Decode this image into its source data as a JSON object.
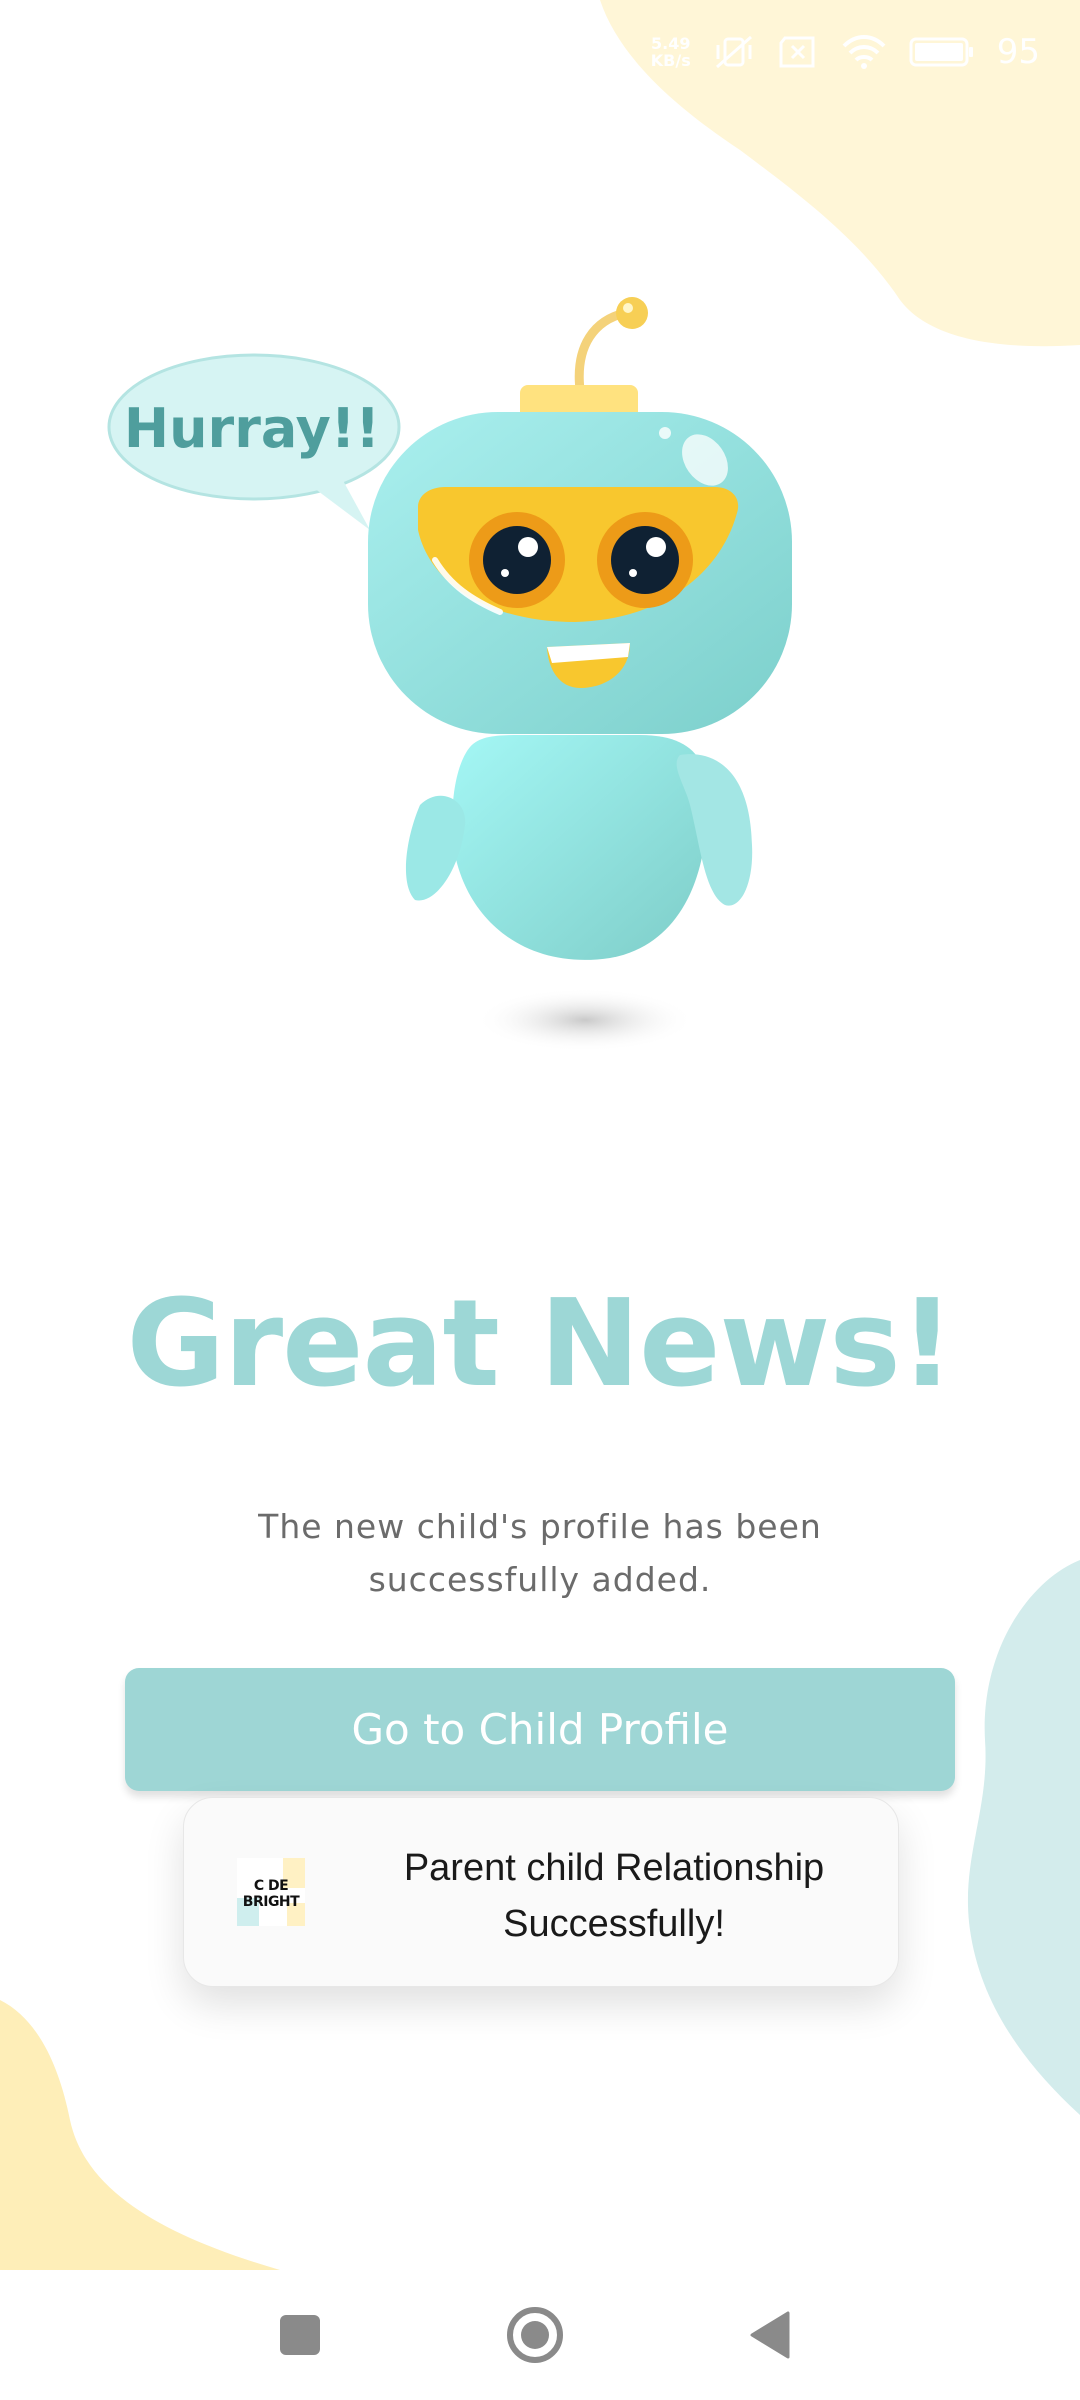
{
  "status_bar": {
    "net_speed_value": "5.49",
    "net_speed_unit": "KB/s",
    "battery_percent": "95"
  },
  "mascot": {
    "speech_bubble": "Hurray!!"
  },
  "main": {
    "title": "Great News!",
    "message": "The new child's profile has been successfully added.",
    "cta_label": "Go to Child Profile"
  },
  "toast": {
    "logo_line1": "C DE",
    "logo_line2": "BRIGHT",
    "message": "Parent child Relationship Successfully!"
  },
  "colors": {
    "teal": "#9ed6d5",
    "yellow_blob": "#fff6d6",
    "teal_blob": "#d2ecec"
  }
}
